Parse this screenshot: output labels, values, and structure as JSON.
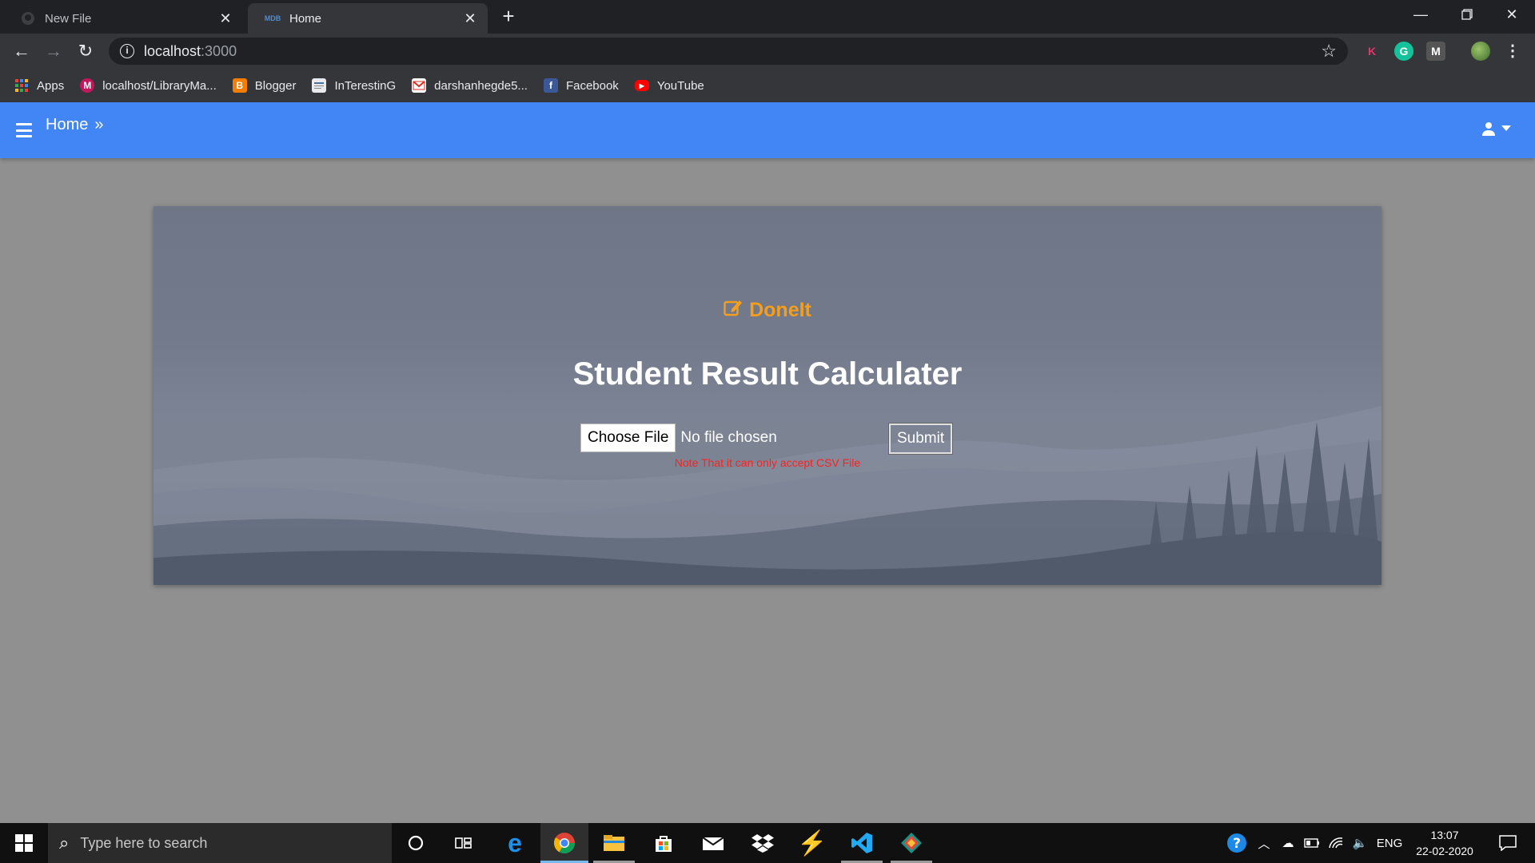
{
  "browser": {
    "tabs": [
      {
        "title": "New File",
        "favicon": "github-icon",
        "active": false
      },
      {
        "title": "Home",
        "favicon": "mdb-icon",
        "favicon_text": "MDB",
        "active": true
      }
    ],
    "url_host": "localhost",
    "url_port": ":3000",
    "extensions": [
      {
        "name": "k-extension-icon",
        "letter": "K",
        "color": "#e8336d"
      },
      {
        "name": "grammarly-icon",
        "letter": "G",
        "color": "#15c39a"
      },
      {
        "name": "m-extension-icon",
        "letter": "M",
        "color": "#555555"
      }
    ],
    "bookmarks": [
      {
        "label": "Apps",
        "icon": "apps-grid-icon"
      },
      {
        "label": "localhost/LibraryMa...",
        "icon": "library-favicon"
      },
      {
        "label": "Blogger",
        "icon": "blogger-icon"
      },
      {
        "label": "InTerestinG",
        "icon": "folder-page-icon"
      },
      {
        "label": "darshanhegde5...",
        "icon": "gmail-icon"
      },
      {
        "label": "Facebook",
        "icon": "facebook-icon"
      },
      {
        "label": "YouTube",
        "icon": "youtube-icon"
      }
    ]
  },
  "app": {
    "breadcrumb": "Home",
    "accent_color": "#4285f4",
    "brand": "DoneIt",
    "brand_color": "#f59e1b",
    "headline": "Student Result Calculater",
    "choose_file_label": "Choose File",
    "no_file_text": "No file chosen",
    "submit_label": "Submit",
    "note": "Note That it can only accept CSV File"
  },
  "taskbar": {
    "search_placeholder": "Type here to search",
    "language": "ENG",
    "time": "13:07",
    "date": "22-02-2020",
    "apps": [
      "cortana-icon",
      "task-view-icon",
      "edge-icon",
      "chrome-icon",
      "file-explorer-icon",
      "store-icon",
      "mail-icon",
      "dropbox-icon",
      "vs-icon",
      "vscode-icon",
      "gitkraken-icon"
    ]
  }
}
